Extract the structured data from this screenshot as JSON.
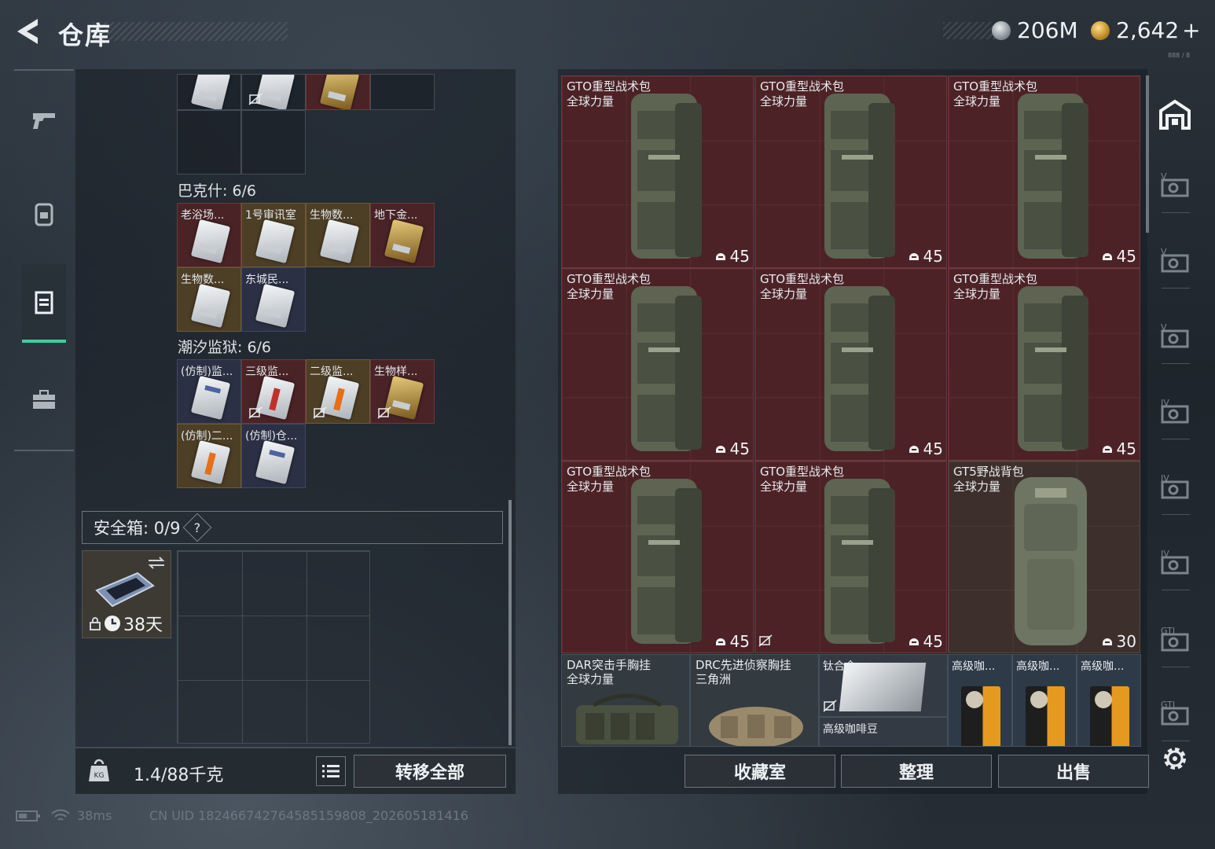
{
  "header": {
    "title": "仓库"
  },
  "currency": {
    "silver": "206M",
    "gold": "2,642",
    "gold_add": "+",
    "tiny_note": "888 / 8"
  },
  "left": {
    "top_row_labels": [],
    "baksh": {
      "label": "巴克什: 6/6",
      "items": [
        "老浴场...",
        "1号审讯室",
        "生物数...",
        "地下金...",
        "生物数...",
        "东城民..."
      ]
    },
    "tidal": {
      "label": "潮汐监狱: 6/6",
      "items": [
        "(仿制)监...",
        "三级监...",
        "二级监...",
        "生物样...",
        "(仿制)二...",
        "(仿制)仓..."
      ]
    },
    "safe_box": {
      "label": "安全箱: 0/9",
      "help": "?",
      "duration": "38天"
    },
    "weight": "1.4/88千克",
    "transfer_all": "转移全部"
  },
  "right": {
    "bags": [
      {
        "name": "GTO重型战术包",
        "sub": "全球力量",
        "cap": "45"
      },
      {
        "name": "GTO重型战术包",
        "sub": "全球力量",
        "cap": "45"
      },
      {
        "name": "GTO重型战术包",
        "sub": "全球力量",
        "cap": "45"
      },
      {
        "name": "GTO重型战术包",
        "sub": "全球力量",
        "cap": "45"
      },
      {
        "name": "GTO重型战术包",
        "sub": "全球力量",
        "cap": "45"
      },
      {
        "name": "GTO重型战术包",
        "sub": "全球力量",
        "cap": "45"
      },
      {
        "name": "GTO重型战术包",
        "sub": "全球力量",
        "cap": "45"
      },
      {
        "name": "GTO重型战术包",
        "sub": "全球力量",
        "cap": "45"
      },
      {
        "name": "GT5野战背包",
        "sub": "全球力量",
        "cap": "30"
      }
    ],
    "rig1": {
      "name": "DAR突击手胸挂",
      "sub": "全球力量"
    },
    "rig2": {
      "name": "DRC先进侦察胸挂",
      "sub": "三角洲"
    },
    "titanium": {
      "name": "钛合金",
      "sub": "高级咖啡豆"
    },
    "coffee": [
      "高级咖...",
      "高级咖...",
      "高级咖..."
    ],
    "buttons": {
      "collection": "收藏室",
      "sort": "整理",
      "sell": "出售"
    }
  },
  "right_col_labels": [
    "V",
    "V",
    "V",
    "IV",
    "IV",
    "IV",
    "GTI",
    "GTI"
  ],
  "footer": {
    "ping": "38ms",
    "uid": "CN UID 1824667427645851598​08_202605181416"
  },
  "colors": {
    "accent": "#3ccf9f",
    "bag_red": "#4c2226",
    "bag_brown": "#3d2f2b"
  },
  "icons": [
    "back-arrow-icon",
    "pistol-icon",
    "backpack-icon",
    "vest-icon",
    "briefcase-icon",
    "no-card-icon",
    "helmet-icon",
    "lock-icon",
    "clock-icon",
    "list-icon",
    "home-icon",
    "gear-icon",
    "battery-icon",
    "wifi-icon"
  ]
}
